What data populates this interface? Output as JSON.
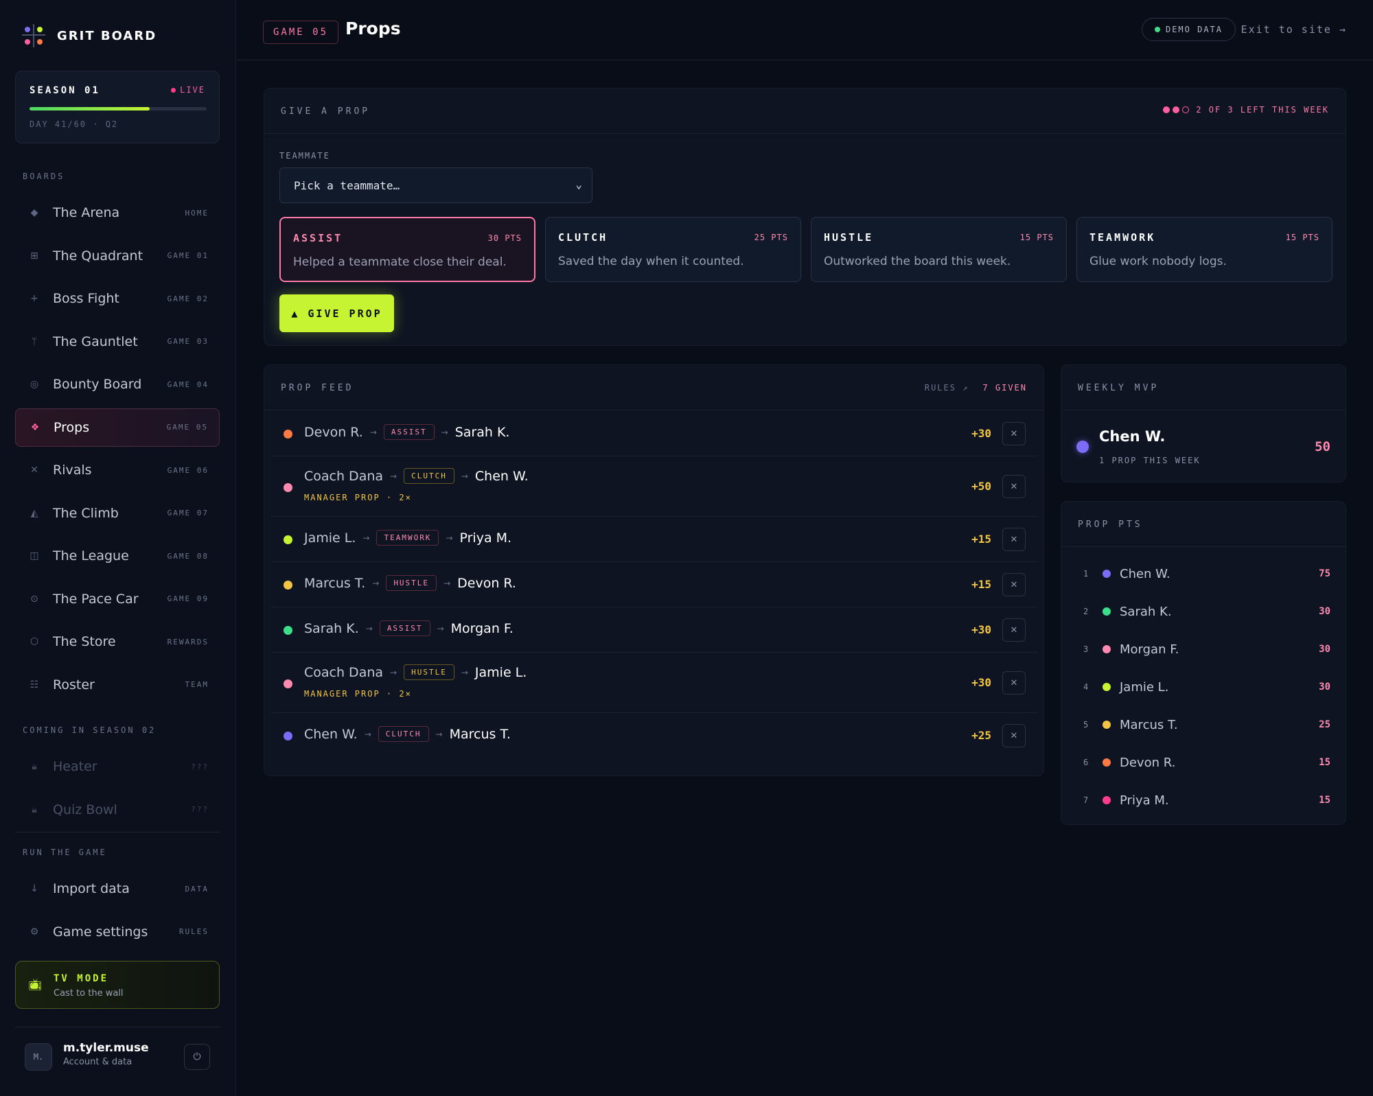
{
  "brand": {
    "name": "GRIT BOARD"
  },
  "season": {
    "title": "SEASON 01",
    "live_label": "LIVE",
    "progress": 0.68,
    "sub": "DAY 41/60 · Q2"
  },
  "sidebar": {
    "boards_label": "BOARDS",
    "boards": [
      {
        "label": "The Arena",
        "tag": "HOME",
        "icon": "diamond-icon",
        "glyph": "◆"
      },
      {
        "label": "The Quadrant",
        "tag": "GAME 01",
        "icon": "grid-icon",
        "glyph": "⊞"
      },
      {
        "label": "Boss Fight",
        "tag": "GAME 02",
        "icon": "crosshair-icon",
        "glyph": "+"
      },
      {
        "label": "The Gauntlet",
        "tag": "GAME 03",
        "icon": "fork-icon",
        "glyph": "ᛘ"
      },
      {
        "label": "Bounty Board",
        "tag": "GAME 04",
        "icon": "target-icon",
        "glyph": "◎"
      },
      {
        "label": "Props",
        "tag": "GAME 05",
        "icon": "sparkle-icon",
        "glyph": "❖",
        "active": true
      },
      {
        "label": "Rivals",
        "tag": "GAME 06",
        "icon": "swords-icon",
        "glyph": "✕"
      },
      {
        "label": "The Climb",
        "tag": "GAME 07",
        "icon": "mountain-icon",
        "glyph": "◭"
      },
      {
        "label": "The League",
        "tag": "GAME 08",
        "icon": "columns-icon",
        "glyph": "◫"
      },
      {
        "label": "The Pace Car",
        "tag": "GAME 09",
        "icon": "gauge-icon",
        "glyph": "⊙"
      },
      {
        "label": "The Store",
        "tag": "REWARDS",
        "icon": "hexagon-icon",
        "glyph": "⬡"
      },
      {
        "label": "Roster",
        "tag": "TEAM",
        "icon": "list-icon",
        "glyph": "☷"
      }
    ],
    "coming_label": "COMING IN SEASON 02",
    "coming": [
      {
        "label": "Heater",
        "tag": "???",
        "icon": "lock-icon",
        "glyph": "🔒︎"
      },
      {
        "label": "Quiz Bowl",
        "tag": "???",
        "icon": "lock-icon",
        "glyph": "🔒︎"
      }
    ],
    "run_label": "RUN THE GAME",
    "run": [
      {
        "label": "Import data",
        "tag": "DATA",
        "icon": "download-icon",
        "glyph": "↓"
      },
      {
        "label": "Game settings",
        "tag": "RULES",
        "icon": "gear-icon",
        "glyph": "⚙"
      }
    ],
    "tv": {
      "title": "TV MODE",
      "sub": "Cast to the wall"
    },
    "user": {
      "initial": "M.",
      "name": "m.tyler.muse",
      "sub": "Account & data"
    }
  },
  "header": {
    "game_tag": "GAME 05",
    "title": "Props",
    "demo_label": "DEMO DATA",
    "exit_label": "Exit to site →"
  },
  "give": {
    "title": "GIVE A PROP",
    "left_text": "2 OF 3 LEFT THIS WEEK",
    "teammate_label": "TEAMMATE",
    "teammate_placeholder": "Pick a teammate…",
    "types": [
      {
        "name": "ASSIST",
        "pts": "30 PTS",
        "desc": "Helped a teammate close their deal.",
        "selected": true
      },
      {
        "name": "CLUTCH",
        "pts": "25 PTS",
        "desc": "Saved the day when it counted."
      },
      {
        "name": "HUSTLE",
        "pts": "15 PTS",
        "desc": "Outworked the board this week."
      },
      {
        "name": "TEAMWORK",
        "pts": "15 PTS",
        "desc": "Glue work nobody logs."
      }
    ],
    "button_label": "▲ GIVE PROP"
  },
  "feed": {
    "title": "PROP FEED",
    "rules_label": "RULES ↗",
    "given_label": "7 GIVEN",
    "rows": [
      {
        "from": "Devon R.",
        "type": "ASSIST",
        "to": "Sarah K.",
        "pts": "+30",
        "color": "#ff7a45",
        "chip": "pink"
      },
      {
        "from": "Coach Dana",
        "type": "CLUTCH",
        "to": "Chen W.",
        "pts": "+50",
        "color": "#ff8ab0",
        "chip": "gold",
        "sub": "MANAGER PROP · 2×"
      },
      {
        "from": "Jamie L.",
        "type": "TEAMWORK",
        "to": "Priya M.",
        "pts": "+15",
        "color": "#c6f432",
        "chip": "pink"
      },
      {
        "from": "Marcus T.",
        "type": "HUSTLE",
        "to": "Devon R.",
        "pts": "+15",
        "color": "#f2c545",
        "chip": "pink"
      },
      {
        "from": "Sarah K.",
        "type": "ASSIST",
        "to": "Morgan F.",
        "pts": "+30",
        "color": "#3de08a",
        "chip": "pink"
      },
      {
        "from": "Coach Dana",
        "type": "HUSTLE",
        "to": "Jamie L.",
        "pts": "+30",
        "color": "#ff8ab0",
        "chip": "gold",
        "sub": "MANAGER PROP · 2×"
      },
      {
        "from": "Chen W.",
        "type": "CLUTCH",
        "to": "Marcus T.",
        "pts": "+25",
        "color": "#7d6cf5",
        "chip": "pink"
      }
    ]
  },
  "mvp": {
    "title": "WEEKLY MVP",
    "name": "Chen W.",
    "sub": "1 PROP THIS WEEK",
    "pts": "50"
  },
  "prop_pts": {
    "title": "PROP PTS",
    "rows": [
      {
        "rank": "1",
        "name": "Chen W.",
        "pts": "75",
        "color": "#7d6cf5"
      },
      {
        "rank": "2",
        "name": "Sarah K.",
        "pts": "30",
        "color": "#3de08a"
      },
      {
        "rank": "3",
        "name": "Morgan F.",
        "pts": "30",
        "color": "#ff8ab0"
      },
      {
        "rank": "4",
        "name": "Jamie L.",
        "pts": "30",
        "color": "#c6f432"
      },
      {
        "rank": "5",
        "name": "Marcus T.",
        "pts": "25",
        "color": "#f2c545"
      },
      {
        "rank": "6",
        "name": "Devon R.",
        "pts": "15",
        "color": "#ff7a45"
      },
      {
        "rank": "7",
        "name": "Priya M.",
        "pts": "15",
        "color": "#ff3d8a"
      }
    ]
  },
  "colors": {
    "accent": "#c6f432",
    "pink": "#ff8ab0",
    "gold": "#f2c545"
  }
}
